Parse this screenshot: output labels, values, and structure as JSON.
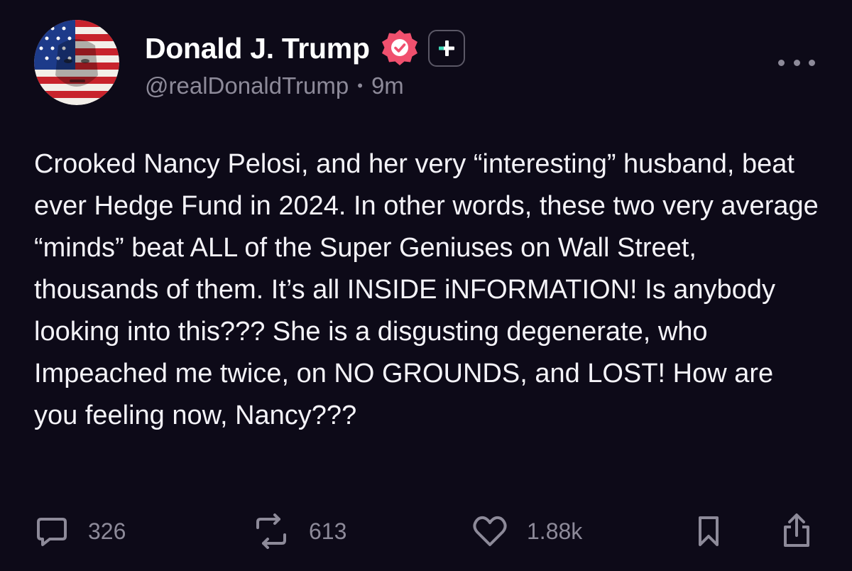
{
  "author": {
    "display_name": "Donald J. Trump",
    "handle": "@realDonaldTrump",
    "separator": "•",
    "timestamp": "9m"
  },
  "post": {
    "text": "Crooked Nancy Pelosi, and her very “interesting” husband, beat ever Hedge Fund in 2024. In other words, these two very average “minds” beat ALL of the Super Geniuses on Wall Street, thousands of them. It’s all INSIDE iNFORMATION! Is anybody looking into this??? She is a disgusting degenerate, who Impeached me twice, on NO GROUNDS, and LOST! How are you feeling now, Nancy???"
  },
  "actions": {
    "replies": "326",
    "reposts": "613",
    "likes": "1.88k"
  },
  "icons": {
    "verified": "verified-badge-icon",
    "subscribe": "plus-icon",
    "more": "more-horizontal-icon",
    "reply": "comment-icon",
    "repost": "repost-icon",
    "like": "heart-icon",
    "bookmark": "bookmark-icon",
    "share": "share-icon"
  },
  "colors": {
    "background": "#0d0a18",
    "verified": "#f0506e",
    "subscribe_accent": "#3dd6b5",
    "muted": "#8d8a99"
  }
}
